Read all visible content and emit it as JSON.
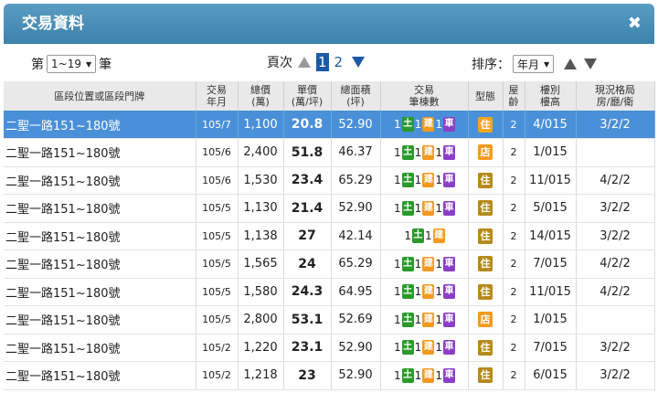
{
  "dialog": {
    "title": "交易資料",
    "close_symbol": "✖"
  },
  "controls": {
    "page_prefix": "第",
    "page_range": "1~19",
    "page_suffix": "筆",
    "pager_label": "頁次",
    "pages": [
      "1",
      "2"
    ],
    "active_page": "1",
    "sort_label": "排序：",
    "sort_value": "年月"
  },
  "columns": [
    "區段位置或區段門牌",
    "交易\n年月",
    "總價\n(萬)",
    "單價\n(萬/坪)",
    "總面積\n(坪)",
    "交易\n筆棟數",
    "型態",
    "屋\n齡",
    "樓別\n樓高",
    "現況格局\n房/廳/衛"
  ],
  "badge_labels": {
    "land": "土",
    "building": "建",
    "car": "車",
    "residential": "住",
    "shop": "店"
  },
  "colors": {
    "header_start": "#5a9cc2",
    "header_end": "#3b82ad",
    "selected_row": "#4a90d9",
    "land": "#2a9a2a",
    "building": "#f39a1e",
    "car": "#8a3fc6"
  },
  "rows": [
    {
      "addr": "二聖一路151~180號",
      "ym": "105/7",
      "total": "1,100",
      "unit": "20.8",
      "area": "52.90",
      "land": "1",
      "bldg": "1",
      "car": "1",
      "type": "住",
      "age": "2",
      "floor": "4/015",
      "layout": "3/2/2",
      "selected": true
    },
    {
      "addr": "二聖一路151~180號",
      "ym": "105/6",
      "total": "2,400",
      "unit": "51.8",
      "area": "46.37",
      "land": "1",
      "bldg": "1",
      "car": "1",
      "type": "店",
      "age": "2",
      "floor": "1/015",
      "layout": ""
    },
    {
      "addr": "二聖一路151~180號",
      "ym": "105/6",
      "total": "1,530",
      "unit": "23.4",
      "area": "65.29",
      "land": "1",
      "bldg": "1",
      "car": "1",
      "type": "住",
      "age": "2",
      "floor": "11/015",
      "layout": "4/2/2"
    },
    {
      "addr": "二聖一路151~180號",
      "ym": "105/5",
      "total": "1,130",
      "unit": "21.4",
      "area": "52.90",
      "land": "1",
      "bldg": "1",
      "car": "1",
      "type": "住",
      "age": "2",
      "floor": "5/015",
      "layout": "3/2/2"
    },
    {
      "addr": "二聖一路151~180號",
      "ym": "105/5",
      "total": "1,138",
      "unit": "27",
      "area": "42.14",
      "land": "1",
      "bldg": "1",
      "car": "",
      "type": "住",
      "age": "2",
      "floor": "14/015",
      "layout": "3/2/2"
    },
    {
      "addr": "二聖一路151~180號",
      "ym": "105/5",
      "total": "1,565",
      "unit": "24",
      "area": "65.29",
      "land": "1",
      "bldg": "1",
      "car": "1",
      "type": "住",
      "age": "2",
      "floor": "7/015",
      "layout": "4/2/2"
    },
    {
      "addr": "二聖一路151~180號",
      "ym": "105/5",
      "total": "1,580",
      "unit": "24.3",
      "area": "64.95",
      "land": "1",
      "bldg": "1",
      "car": "1",
      "type": "住",
      "age": "2",
      "floor": "11/015",
      "layout": "4/2/2"
    },
    {
      "addr": "二聖一路151~180號",
      "ym": "105/5",
      "total": "2,800",
      "unit": "53.1",
      "area": "52.69",
      "land": "1",
      "bldg": "1",
      "car": "1",
      "type": "店",
      "age": "2",
      "floor": "1/015",
      "layout": ""
    },
    {
      "addr": "二聖一路151~180號",
      "ym": "105/2",
      "total": "1,220",
      "unit": "23.1",
      "area": "52.90",
      "land": "1",
      "bldg": "1",
      "car": "1",
      "type": "住",
      "age": "2",
      "floor": "7/015",
      "layout": "3/2/2"
    },
    {
      "addr": "二聖一路151~180號",
      "ym": "105/2",
      "total": "1,218",
      "unit": "23",
      "area": "52.90",
      "land": "1",
      "bldg": "1",
      "car": "1",
      "type": "住",
      "age": "2",
      "floor": "6/015",
      "layout": "3/2/2"
    }
  ]
}
